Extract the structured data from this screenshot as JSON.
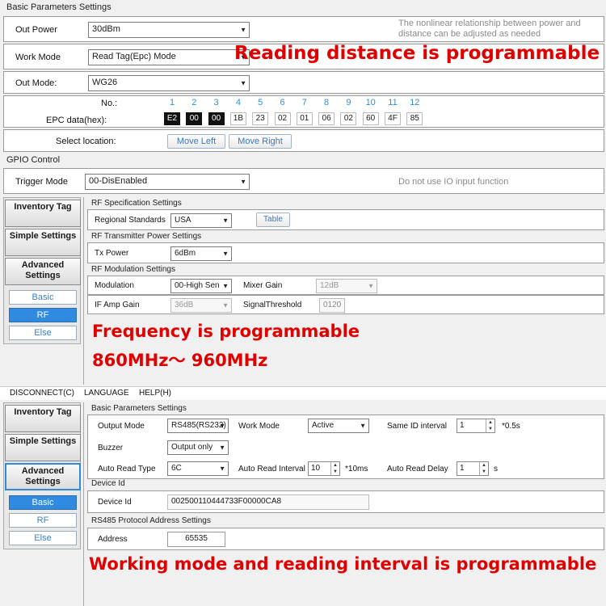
{
  "panel1": {
    "group_title": "Basic Parameters Settings",
    "out_power": {
      "label": "Out Power",
      "value": "30dBm"
    },
    "hint_power": "The nonlinear relationship between power and distance can be adjusted as needed",
    "work_mode": {
      "label": "Work Mode",
      "value": "Read Tag(Epc) Mode"
    },
    "out_mode": {
      "label": "Out Mode:",
      "value": "WG26"
    },
    "epc": {
      "no_label": "No.:",
      "data_label": "EPC data(hex):",
      "numbers": [
        "1",
        "2",
        "3",
        "4",
        "5",
        "6",
        "7",
        "8",
        "9",
        "10",
        "11",
        "12"
      ],
      "bytes": [
        "E2",
        "00",
        "00",
        "1B",
        "23",
        "02",
        "01",
        "06",
        "02",
        "60",
        "4F",
        "85"
      ]
    },
    "select_location": {
      "label": "Select location:",
      "move_left": "Move Left",
      "move_right": "Move Right"
    },
    "gpio_title": "GPIO Control",
    "trigger_mode": {
      "label": "Trigger Mode",
      "value": "00-DisEnabled"
    },
    "hint_io": "Do not use IO input function",
    "annotation": "Reading distance is programmable"
  },
  "panel2": {
    "side": {
      "inventory": "Inventory Tag",
      "simple": "Simple Settings",
      "advanced": "Advanced Settings",
      "basic": "Basic",
      "rf": "RF",
      "else": "Else"
    },
    "rf_spec_title": "RF Specification Settings",
    "regional": {
      "label": "Regional Standards",
      "value": "USA",
      "table_button": "Table"
    },
    "tx_title": "RF Transmitter Power Settings",
    "tx_power": {
      "label": "Tx Power",
      "value": "6dBm"
    },
    "mod_title": "RF Modulation Settings",
    "modulation": {
      "label": "Modulation",
      "value": "00-High Sen"
    },
    "mixer_gain": {
      "label": "Mixer Gain",
      "value": "12dB"
    },
    "if_amp": {
      "label": "IF Amp Gain",
      "value": "36dB"
    },
    "signal_threshold": {
      "label": "SignalThreshold",
      "value": "0120"
    },
    "annotation_1": "Frequency is programmable",
    "annotation_2": "860MHz～ 960MHz"
  },
  "panel3": {
    "menu": {
      "disconnect": "DISCONNECT(C)",
      "language": "LANGUAGE",
      "help": "HELP(H)"
    },
    "side": {
      "inventory": "Inventory Tag",
      "simple": "Simple Settings",
      "advanced": "Advanced Settings",
      "basic": "Basic",
      "rf": "RF",
      "else": "Else"
    },
    "group_title": "Basic Parameters Settings",
    "output_mode": {
      "label": "Output Mode",
      "value": "RS485(RS232)"
    },
    "work_mode": {
      "label": "Work Mode",
      "value": "Active"
    },
    "same_id": {
      "label": "Same ID interval",
      "value": "1",
      "unit": "*0.5s"
    },
    "buzzer": {
      "label": "Buzzer",
      "value": "Output only"
    },
    "auto_read_type": {
      "label": "Auto Read Type",
      "value": "6C"
    },
    "auto_read_interval": {
      "label": "Auto Read Interval",
      "value": "10",
      "unit": "*10ms"
    },
    "auto_read_delay": {
      "label": "Auto Read Delay",
      "value": "1",
      "unit": "s"
    },
    "device_id_title": "Device Id",
    "device_id": {
      "label": "Device Id",
      "value": "002500110444733F00000CA8"
    },
    "rs485_title": "RS485 Protocol Address Settings",
    "address": {
      "label": "Address",
      "value": "65535"
    },
    "annotation": "Working mode and reading interval is programmable"
  }
}
